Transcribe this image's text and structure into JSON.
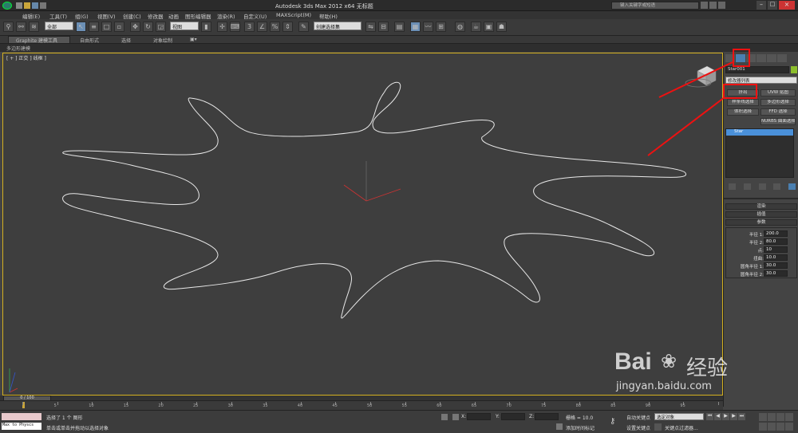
{
  "window": {
    "title": "Autodesk 3ds Max  2012 x64    无标题",
    "search_placeholder": "键入关键字或短语"
  },
  "menu": [
    "编辑(E)",
    "工具(T)",
    "组(G)",
    "视图(V)",
    "创建(C)",
    "修改器",
    "动画",
    "图形编辑器",
    "渲染(R)",
    "自定义(U)",
    "MAXScript(M)",
    "帮助(H)"
  ],
  "toolbar": {
    "selection_filter": "全部",
    "ref_coord": "视图",
    "named_selection": "创建选择集"
  },
  "ribbon": {
    "tabs": [
      "Graphite 建模工具",
      "自由形式",
      "选择",
      "对象绘制"
    ],
    "subtab": "多边形建模"
  },
  "viewport": {
    "label": "[ + ] 正交 ] 线框 ]"
  },
  "cmdpanel": {
    "object_name": "Star001",
    "modifier_list": "修改器列表",
    "buttons": [
      "挤出",
      "UVW 贴图",
      "样条线选择",
      "多边形选择",
      "体积选择",
      "FFD 选择",
      "NURBS 曲面选择"
    ],
    "stack_item": "Star",
    "rollouts": [
      "渲染",
      "插值",
      "参数"
    ],
    "params": [
      {
        "label": "半径 1:",
        "value": "200.0"
      },
      {
        "label": "半径 2:",
        "value": "80.0"
      },
      {
        "label": "点:",
        "value": "10"
      },
      {
        "label": "扭曲:",
        "value": "10.0"
      },
      {
        "label": "圆角半径 1:",
        "value": "30.0"
      },
      {
        "label": "圆角半径 2:",
        "value": "30.0"
      }
    ],
    "accent": "#4a90d9"
  },
  "timeline": {
    "frame": "0 / 100",
    "ticks": [
      "0",
      "5",
      "10",
      "15",
      "20",
      "25",
      "30",
      "35",
      "40",
      "45",
      "50",
      "55",
      "60",
      "65",
      "70",
      "75",
      "80",
      "85",
      "90",
      "95",
      "100"
    ]
  },
  "status": {
    "script_listener": "Max to Physcs",
    "line1": "选择了 1 个 图形",
    "line2": "单击或单击并拖动以选择对象",
    "x_label": "X:",
    "y_label": "Y:",
    "z_label": "Z:",
    "grid": "栅格 = 10.0",
    "add_time_tag": "添加时间标记",
    "auto_key": "自动关键点",
    "set_key": "设置关键点",
    "selected": "选定对象",
    "key_filter": "关键点过滤器..."
  },
  "watermark": {
    "brand": "Bai",
    "brand2": "经验",
    "url": "jingyan.baidu.com"
  }
}
